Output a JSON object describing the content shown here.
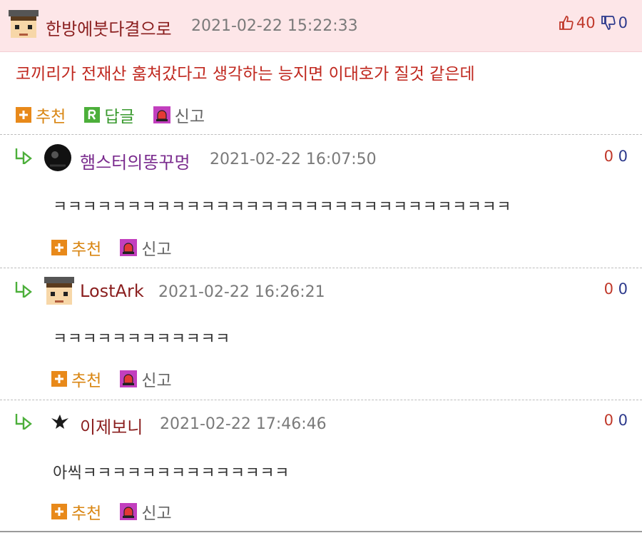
{
  "main_comment": {
    "nickname": "한방에붓다결으로",
    "timestamp": "2021-02-22 15:22:33",
    "upvotes": "40",
    "downvotes": "0",
    "text": "코끼리가 전재산 훔쳐갔다고 생각하는 능지면 이대호가 질것 같은데",
    "actions": {
      "recommend": "추천",
      "reply": "답글",
      "report": "신고"
    }
  },
  "replies": [
    {
      "nickname": "햄스터의똥꾸멍",
      "timestamp": "2021-02-22 16:07:50",
      "upvotes": "0",
      "downvotes": "0",
      "text": "ㅋㅋㅋㅋㅋㅋㅋㅋㅋㅋㅋㅋㅋㅋㅋㅋㅋㅋㅋㅋㅋㅋㅋㅋㅋㅋㅋㅋㅋㅋㅋ",
      "actions": {
        "recommend": "추천",
        "report": "신고"
      }
    },
    {
      "nickname": "LostArk",
      "timestamp": "2021-02-22 16:26:21",
      "upvotes": "0",
      "downvotes": "0",
      "text": "ㅋㅋㅋㅋㅋㅋㅋㅋㅋㅋㅋㅋ",
      "actions": {
        "recommend": "추천",
        "report": "신고"
      }
    },
    {
      "nickname": "이제보니",
      "timestamp": "2021-02-22 17:46:46",
      "upvotes": "0",
      "downvotes": "0",
      "text": "아씩ㅋㅋㅋㅋㅋㅋㅋㅋㅋㅋㅋㅋㅋㅋ",
      "actions": {
        "recommend": "추천",
        "report": "신고"
      }
    }
  ],
  "icons": {
    "thumbs_up": "thumbs-up-icon",
    "thumbs_down": "thumbs-down-icon",
    "recommend": "plus-icon",
    "reply": "reply-r-icon",
    "report": "siren-icon",
    "reply_arrow": "reply-arrow-icon"
  },
  "colors": {
    "header_bg": "#fde6e8",
    "main_text": "#c0281f",
    "recommend": "#d98613",
    "reply": "#3a9a2f",
    "upvote": "#c0392b",
    "downvote": "#2d3a8c"
  }
}
